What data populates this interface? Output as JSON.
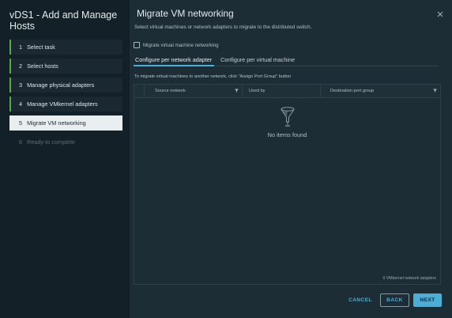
{
  "wizard": {
    "title": "vDS1 - Add and Manage Hosts",
    "steps": [
      {
        "num": "1",
        "label": "Select task",
        "state": "done"
      },
      {
        "num": "2",
        "label": "Select hosts",
        "state": "done"
      },
      {
        "num": "3",
        "label": "Manage physical adapters",
        "state": "done"
      },
      {
        "num": "4",
        "label": "Manage VMkernel adapters",
        "state": "done"
      },
      {
        "num": "5",
        "label": "Migrate VM networking",
        "state": "active"
      },
      {
        "num": "6",
        "label": "Ready to complete",
        "state": "disabled"
      }
    ]
  },
  "page": {
    "title": "Migrate VM networking",
    "subtitle": "Select virtual machines or network adapters to migrate to the distributed switch.",
    "checkbox_label": "Migrate virtual machine networking",
    "tabs": [
      "Configure per network adapter",
      "Configure per virtual machine"
    ],
    "hint": "To migrate virtual machines to another network, click \"Assign Port Group\" button"
  },
  "grid": {
    "columns": [
      "Source network",
      "Used by",
      "Destination port group"
    ],
    "empty_text": "No items found",
    "footer": "0 VMkernel network adapters"
  },
  "buttons": {
    "cancel": "CANCEL",
    "back": "BACK",
    "next": "NEXT"
  },
  "colors": {
    "accent": "#49afd9",
    "step_marker": "#5aa84a",
    "background": "#1d2d36",
    "sidebar": "#142028"
  }
}
